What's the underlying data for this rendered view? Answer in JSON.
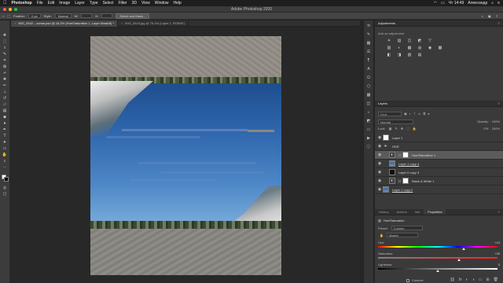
{
  "menubar": {
    "apple": "",
    "app_name": "Photoshop",
    "items": [
      "File",
      "Edit",
      "Image",
      "Layer",
      "Type",
      "Select",
      "Filter",
      "3D",
      "View",
      "Window",
      "Help"
    ],
    "clock": "Чт 14:49",
    "user": "Александр"
  },
  "window": {
    "title": "Adobe Photoshop 2020"
  },
  "options": {
    "feather_label": "Feather:",
    "feather_value": "0 px",
    "style_label": "Style:",
    "style_value": "Normal",
    "width_label": "W:",
    "height_label": "H:",
    "select_mask_label": "Select and Mask..."
  },
  "tabs": [
    {
      "label": "IMG_0642 – копия.psd @ 18,2% (Hue/Saturation 1, Layer Mask/8) *",
      "active": true
    },
    {
      "label": "IMG_0643.jpg @ 75,1% (Layer 1, RGB/8*)",
      "active": false
    }
  ],
  "toolbar": {
    "tools": [
      "move",
      "marquee",
      "lasso",
      "quick-select",
      "crop",
      "frame",
      "eyedropper",
      "heal",
      "brush",
      "stamp",
      "history-brush",
      "eraser",
      "gradient",
      "blur",
      "dodge",
      "pen",
      "type",
      "path-select",
      "rectangle",
      "hand",
      "zoom",
      "more"
    ]
  },
  "adjustments": {
    "title": "Adjustments",
    "hint": "Add an adjustment",
    "icons": [
      "☀",
      "▥",
      "◫",
      "◩",
      "▽",
      "",
      "",
      "",
      "▧",
      "◐",
      "▦",
      "◍",
      "◉",
      "▩",
      "",
      "",
      "◧",
      "◨",
      "▨",
      "▤",
      "",
      "",
      "",
      ""
    ]
  },
  "layers": {
    "tabs": [
      "Layers",
      "Channels",
      "Paths"
    ],
    "filter_label": "Kind",
    "blend_mode": "Normal",
    "opacity_label": "Opacity:",
    "opacity_value": "100%",
    "lock_label": "Lock:",
    "fill_label": "Fill:",
    "fill_value": "100%",
    "rows": [
      {
        "name": "Layer 1",
        "thumb": "white",
        "indent": false,
        "underline": false,
        "selected": false,
        "visible": true,
        "kind": "pixel"
      },
      {
        "name": "HDR",
        "thumb": "folder",
        "indent": false,
        "underline": false,
        "selected": false,
        "visible": true,
        "kind": "group"
      },
      {
        "name": "Hue/Saturation 1",
        "thumb": "adj",
        "indent": true,
        "underline": false,
        "selected": true,
        "visible": true,
        "kind": "adjustment"
      },
      {
        "name": "Layer 1 copy 4",
        "thumb": "photo",
        "indent": true,
        "underline": true,
        "selected": false,
        "visible": true,
        "kind": "pixel"
      },
      {
        "name": "Layer 0 copy 3",
        "thumb": "black",
        "indent": true,
        "underline": false,
        "selected": false,
        "visible": true,
        "kind": "pixel"
      },
      {
        "name": "Black & White 1",
        "thumb": "adj",
        "indent": true,
        "underline": false,
        "selected": false,
        "visible": true,
        "kind": "adjustment"
      },
      {
        "name": "Layer 1 copy 2",
        "thumb": "photo",
        "indent": false,
        "underline": true,
        "selected": false,
        "visible": true,
        "kind": "pixel"
      }
    ],
    "footer_icons": [
      "⛓",
      "fx",
      "◐",
      "◑",
      "▭",
      "⊞",
      "🗑"
    ]
  },
  "properties": {
    "tabs": [
      "History",
      "Actions",
      "Info",
      "Properties"
    ],
    "active_tab": "Properties",
    "title": "Hue/Saturation",
    "preset_label": "Preset:",
    "preset_value": "Custom",
    "channel_value": "Master",
    "hue_label": "Hue:",
    "hue_value": "+43",
    "hue_fraction": 0.72,
    "saturation_label": "Saturation:",
    "saturation_value": "+35",
    "saturation_fraction": 0.68,
    "lightness_label": "Lightness:",
    "lightness_value": "0",
    "lightness_fraction": 0.5,
    "colorize_label": "Colorize"
  },
  "canvas": {
    "background": "#282828"
  }
}
